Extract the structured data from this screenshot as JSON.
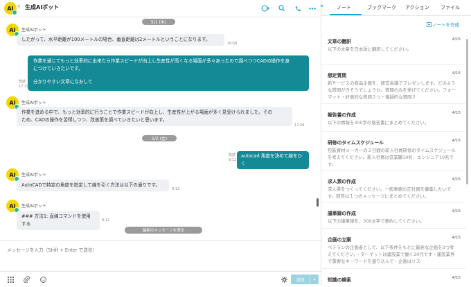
{
  "header": {
    "avatar_text": "AI",
    "small_label": "社",
    "title": "生成AIボット"
  },
  "messages": {
    "date1": "5/1 (木)",
    "date2": "5/2 (金)",
    "bot_name": "生成AIボット",
    "m1_text": "したがって、水平距離が100メートルの場合、垂直距離は2メートルということになります。",
    "m1_time": "16:58",
    "u1_line1": "作業を通じてもっと効率的に出来たら作業スピードが向上し生産性が高くなる場面が多々あったので調べつつCADの操作を身",
    "u1_line2": "につけていきたいです。",
    "u1_line3": "分かりやすい文章になおして",
    "u1_read": "既読",
    "u1_time": "17:29",
    "m2_line1": "作業を進める中で、もっと効率的に行うことで作業スピードが向上し、生産性が上がる場面が多く見受けられました。その",
    "m2_line2": "ため、CADの操作を習得しつつ、改善策を調べていきたいと思います。",
    "m2_time": "17:29",
    "u2_text": "autocad 角度を決めて線をひく",
    "u2_read": "既読",
    "u2_time": "9:12",
    "m3_text": "AutoCADで特定の角度を指定して線を引く方法は以下の通りです。",
    "m3_time": "9:12",
    "m4_text": "### 方法1: 直線コマンドを使用する",
    "m4_time": "9:12",
    "latest_label": "最新のメッセージを表示"
  },
  "input": {
    "placeholder": "メッセージを入力（Shift + Enter で送信）",
    "send_label": "送信"
  },
  "right_panel": {
    "tabs": [
      "ノート",
      "ブックマーク",
      "アクション",
      "ファイル"
    ],
    "create_label": "ノートを作成",
    "notes": [
      {
        "title": "文章の翻訳",
        "date": "4/15",
        "body": "以下の文章を日本語に翻訳してください。"
      },
      {
        "title": "想定質問",
        "date": "4/15",
        "body": "新サービスの商品企画を、経営会議でプレゼンします。どのような質問がきそうでしょうか。質問のみを挙げてください。フォーマット・好意的な質問２つ・懐疑的な質問２"
      },
      {
        "title": "報告書の作成",
        "date": "4/15",
        "body": "以下の情報を300字の報告書にまとめてください。"
      },
      {
        "title": "研修のタイムスケジュール",
        "date": "4/15",
        "body": "包装資材メーカーの３日間の新入社員研修のタイムスケジュールを考えてください。新入社員は営業職10名、エンジニア10名です。"
      },
      {
        "title": "求人票の作成",
        "date": "4/15",
        "body": "求人票をつくってください。一般事務の正社員を募集したいです。回答は１つのメッセージにまとめてください。"
      },
      {
        "title": "議事録の作成",
        "date": "4/15",
        "body": "以下の議事録を、300文字で要約してください。"
      },
      {
        "title": "企画の立案",
        "date": "4/15",
        "body": "ベテランの企画者として、以下条件をもとに最高な企画を3つ考えてください。・ターゲットは建設業で働く20代です・建設業界で重要なキーワードを盛り込んで・企画はリス"
      },
      {
        "title": "知識の検索",
        "date": "4/15",
        "body": ""
      }
    ]
  }
}
